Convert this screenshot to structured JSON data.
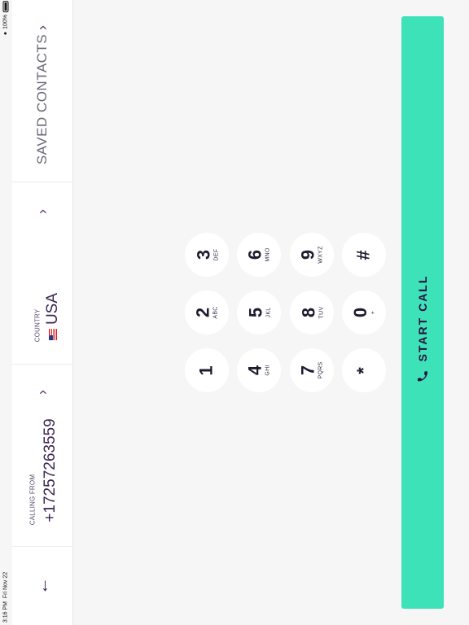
{
  "status": {
    "time": "3:16 PM",
    "date": "Fri Nov 22",
    "battery": "100%"
  },
  "nav": {
    "calling_from_label": "CALLING FROM",
    "calling_from_number": "+17257263559",
    "country_label": "COUNTRY",
    "country_value": "USA",
    "saved_contacts_label": "SAVED CONTACTS"
  },
  "keypad": {
    "keys": [
      {
        "digit": "1",
        "letters": ""
      },
      {
        "digit": "2",
        "letters": "ABC"
      },
      {
        "digit": "3",
        "letters": "DEF"
      },
      {
        "digit": "4",
        "letters": "GHI"
      },
      {
        "digit": "5",
        "letters": "JKL"
      },
      {
        "digit": "6",
        "letters": "MNO"
      },
      {
        "digit": "7",
        "letters": "PQRS"
      },
      {
        "digit": "8",
        "letters": "TUV"
      },
      {
        "digit": "9",
        "letters": "WXYZ"
      },
      {
        "digit": "*",
        "letters": ""
      },
      {
        "digit": "0",
        "letters": "+"
      },
      {
        "digit": "#",
        "letters": ""
      }
    ]
  },
  "call_button": {
    "label": "START CALL",
    "icon": "phone-icon",
    "color": "#3de2b8"
  },
  "colors": {
    "accent": "#3de2b8",
    "text_dark": "#3b2350",
    "background": "#f6f6f6"
  }
}
